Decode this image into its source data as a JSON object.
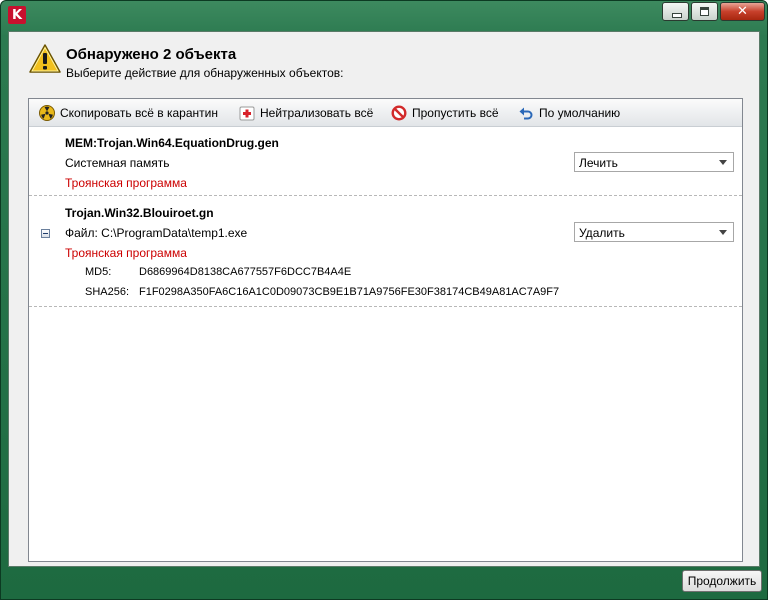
{
  "window": {
    "app_icon_letter": "K",
    "close_glyph": "✕"
  },
  "header": {
    "title": "Обнаружено 2 объекта",
    "subtitle": "Выберите действие для обнаруженных объектов:"
  },
  "toolbar": {
    "quarantine_label": "Скопировать всё в карантин",
    "neutralize_label": "Нейтрализовать всё",
    "skip_label": "Пропустить всё",
    "default_label": "По умолчанию"
  },
  "objects": [
    {
      "name": "MEM:Trojan.Win64.EquationDrug.gen",
      "location": "Системная память",
      "verdict": "Троянская программа",
      "action": "Лечить"
    },
    {
      "name": "Trojan.Win32.Blouiroet.gn",
      "location": "Файл: C:\\ProgramData\\temp1.exe",
      "verdict": "Троянская программа",
      "action": "Удалить",
      "md5_label": "MD5:",
      "md5": "D6869964D8138CA677557F6DCC7B4A4E",
      "sha256_label": "SHA256:",
      "sha256": "F1F0298A350FA6C16A1C0D09073CB9E1B71A9756FE30F38174CB49A81AC7A9F7"
    }
  ],
  "footer": {
    "continue_label": "Продолжить"
  },
  "colors": {
    "frame": "#1d6a40",
    "verdict": "#cc0000",
    "warning": "#f2c01d"
  },
  "icons": {
    "app": "kaspersky-k-icon",
    "warning": "warning-triangle-icon",
    "quarantine": "biohazard-icon",
    "neutralize": "first-aid-icon",
    "skip": "no-entry-icon",
    "default": "undo-arrow-icon",
    "collapse": "collapse-minus-icon"
  }
}
